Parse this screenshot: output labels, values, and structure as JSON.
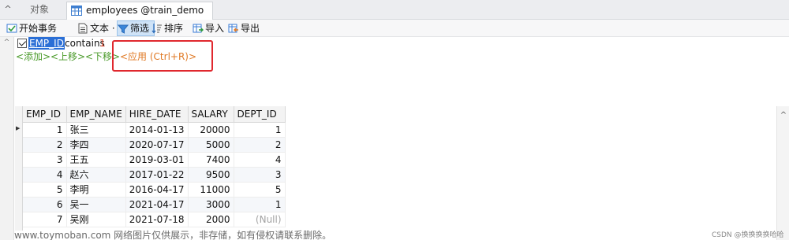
{
  "tabs": {
    "inactive_label": "对象",
    "active_label": "employees @train_demo (l..."
  },
  "toolbar": {
    "begin_transaction": "开始事务",
    "text": "文本 ·",
    "filter": "筛选",
    "sort": "排序",
    "import": "导入",
    "export": "导出"
  },
  "filter": {
    "field": "EMP_ID",
    "operator": "contains",
    "value": "1"
  },
  "actions": {
    "add": "<添加>",
    "move_up": "<上移>",
    "move_down": "<下移>",
    "apply": "<应用 (Ctrl+R)>"
  },
  "grid": {
    "columns": [
      "EMP_ID",
      "EMP_NAME",
      "HIRE_DATE",
      "SALARY",
      "DEPT_ID"
    ],
    "rows": [
      [
        "1",
        "张三",
        "2014-01-13",
        "20000",
        "1"
      ],
      [
        "2",
        "李四",
        "2020-07-17",
        "5000",
        "2"
      ],
      [
        "3",
        "王五",
        "2019-03-01",
        "7400",
        "4"
      ],
      [
        "4",
        "赵六",
        "2017-01-22",
        "9500",
        "3"
      ],
      [
        "5",
        "李明",
        "2016-04-17",
        "11000",
        "5"
      ],
      [
        "6",
        "吴一",
        "2021-04-17",
        "3000",
        "1"
      ],
      [
        "7",
        "吴刚",
        "2021-07-18",
        "2000",
        "(Null)"
      ]
    ]
  },
  "watermark": {
    "text": "www.toymoban.com 网络图片仅供展示，非存储，如有侵权请联系删除。",
    "csdn": "CSDN @换换换换哈哈"
  },
  "colors": {
    "filter_field_bg": "#2b6fd6",
    "action_green": "#4a9a2a",
    "apply_orange": "#e07a26",
    "highlight_red": "#e0282e",
    "null_gray": "#a3a3a3"
  }
}
